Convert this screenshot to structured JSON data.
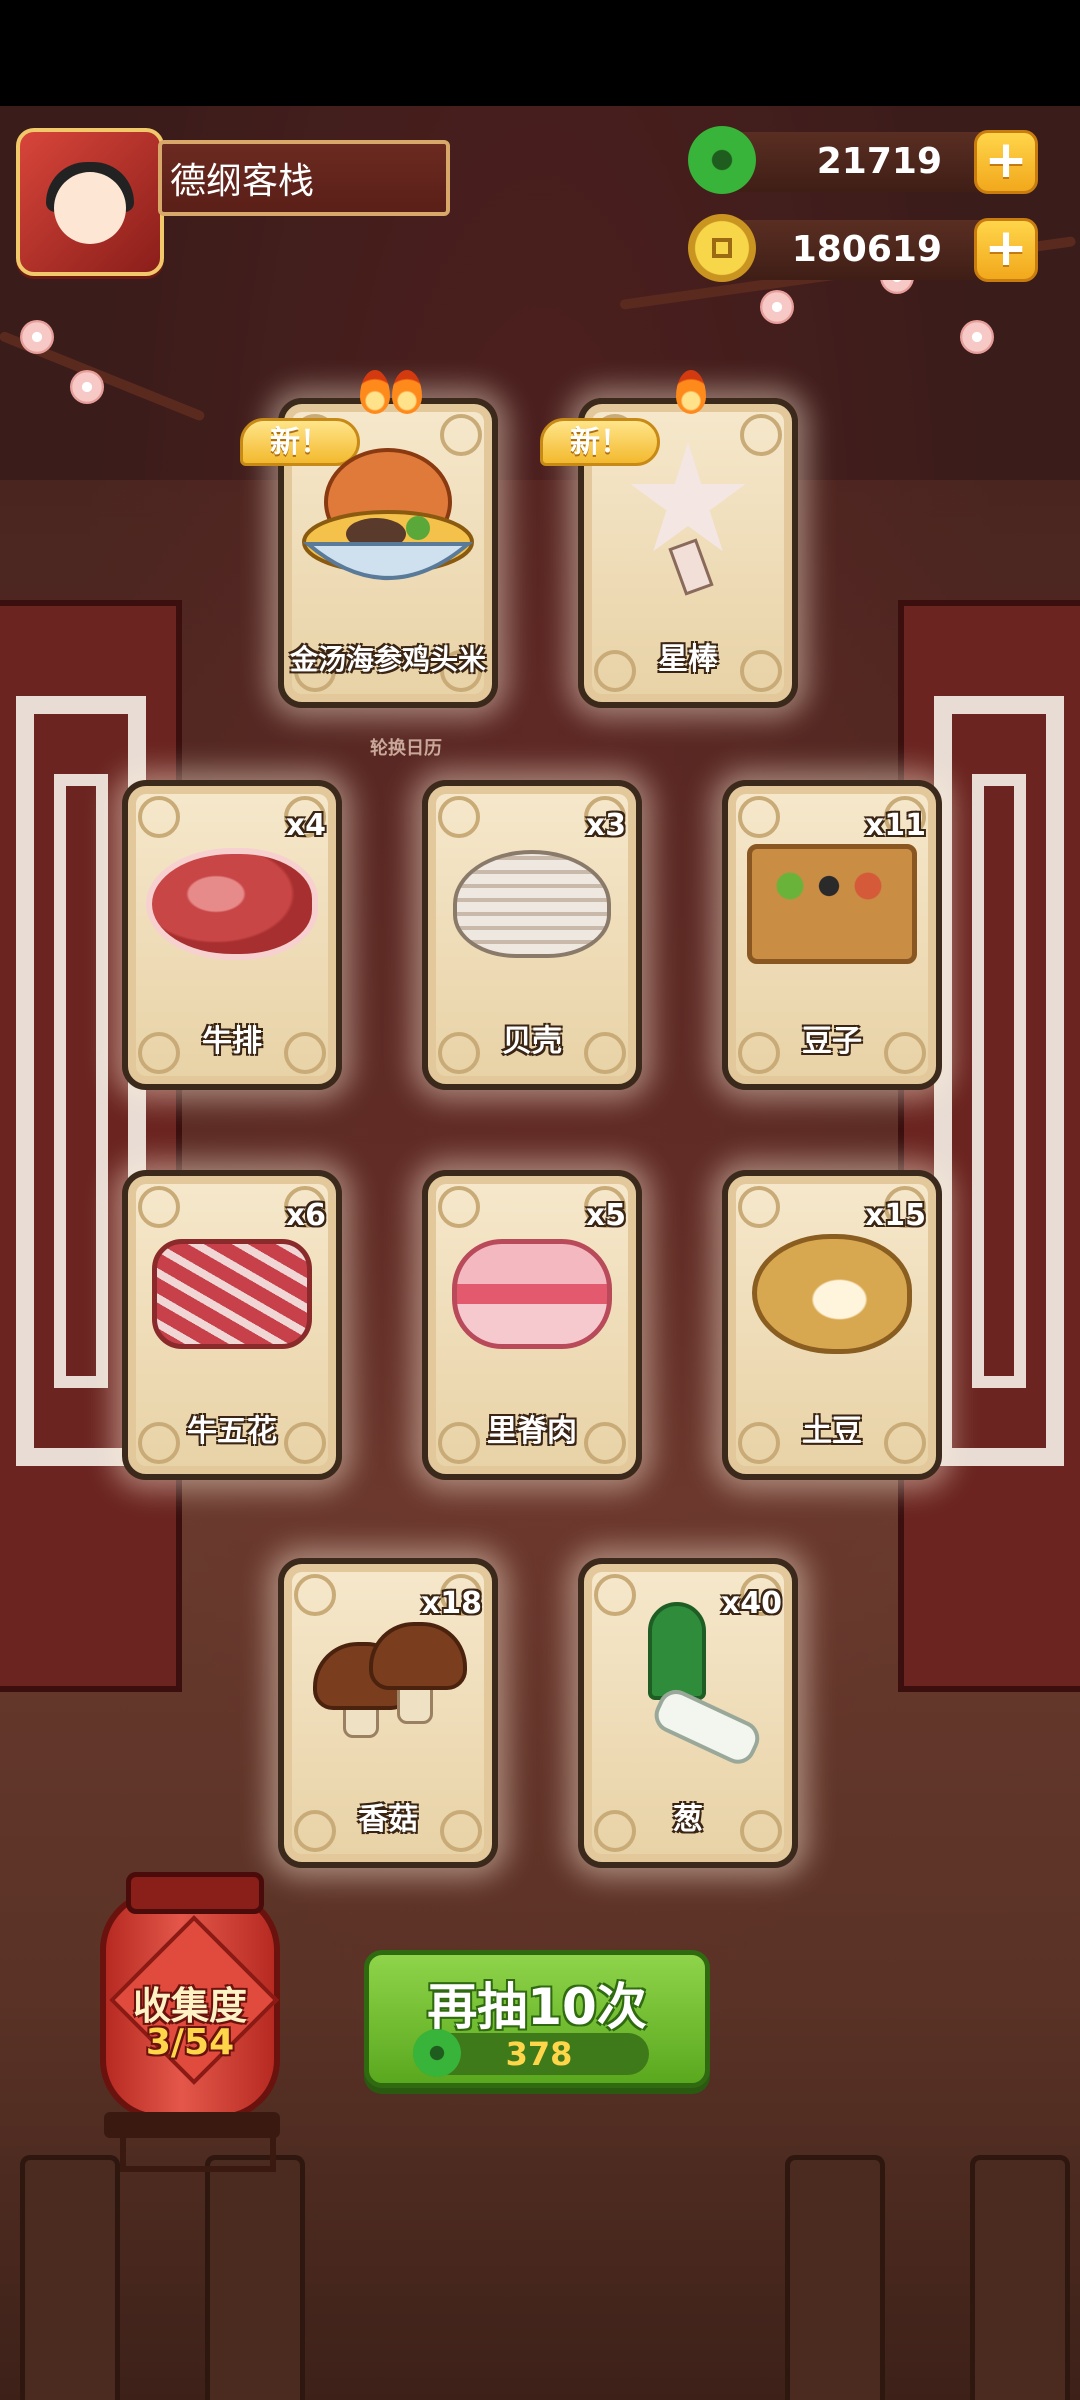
{
  "header": {
    "shop_name": "德纲客栈",
    "jade_amount": "21719",
    "coin_amount": "180619"
  },
  "new_tag_text": "新！",
  "caption": "轮换日历",
  "cards": [
    {
      "name": "金汤海参鸡头米",
      "count": "",
      "is_new": true,
      "art": "soup-bowl-icon"
    },
    {
      "name": "星棒",
      "count": "",
      "is_new": true,
      "art": "star-stick-icon"
    },
    {
      "name": "牛排",
      "count": "x4",
      "is_new": false,
      "art": "steak-icon"
    },
    {
      "name": "贝壳",
      "count": "x3",
      "is_new": false,
      "art": "shell-icon"
    },
    {
      "name": "豆子",
      "count": "x11",
      "is_new": false,
      "art": "bean-box-icon"
    },
    {
      "name": "牛五花",
      "count": "x6",
      "is_new": false,
      "art": "beef-belly-icon"
    },
    {
      "name": "里脊肉",
      "count": "x5",
      "is_new": false,
      "art": "tenderloin-icon"
    },
    {
      "name": "土豆",
      "count": "x15",
      "is_new": false,
      "art": "potato-icon"
    },
    {
      "name": "香菇",
      "count": "x18",
      "is_new": false,
      "art": "mushroom-icon"
    },
    {
      "name": "葱",
      "count": "x40",
      "is_new": false,
      "art": "scallion-icon"
    }
  ],
  "collection": {
    "title": "收集度",
    "progress": "3/54"
  },
  "draw_button": {
    "label": "再抽10次",
    "cost": "378"
  },
  "colors": {
    "accent_green": "#5aa81e",
    "gold": "#f2a81c",
    "lantern_red": "#e4574a"
  }
}
